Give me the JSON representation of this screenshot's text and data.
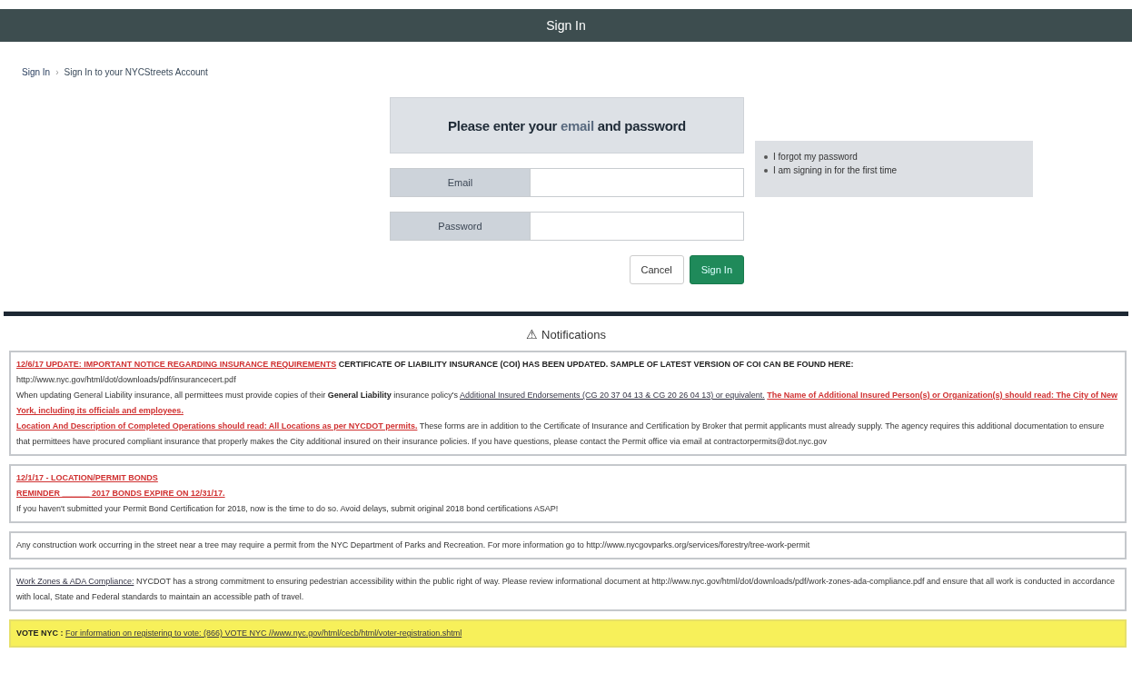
{
  "header": {
    "title": "Sign In"
  },
  "breadcrumb": [
    {
      "label": "Sign In",
      "kind": "link"
    },
    {
      "label": "›",
      "kind": "separator"
    },
    {
      "label": "Sign In to your NYCStreets Account",
      "kind": "current"
    }
  ],
  "form": {
    "heading": [
      {
        "text": "Please enter your ",
        "kind": "plain"
      },
      {
        "text": "email",
        "kind": "mark"
      },
      {
        "text": " and password",
        "kind": "plain"
      }
    ],
    "fields": [
      {
        "label": "Email"
      },
      {
        "label": "Password"
      }
    ],
    "buttons": [
      {
        "label": "Cancel",
        "kind": "secondary"
      },
      {
        "label": "Sign In",
        "kind": "primary"
      }
    ]
  },
  "help_links": [
    "I forgot my password",
    "I am signing in for the first time"
  ],
  "notifications": {
    "icon": "⚠",
    "title": "Notifications",
    "items": [
      {
        "highlighted": false,
        "lines": [
          [
            {
              "text": "12/6/17 UPDATE: IMPORTANT NOTICE REGARDING INSURANCE REQUIREMENTS",
              "kind": "alert"
            },
            {
              "text": "CERTIFICATE OF LIABILITY INSURANCE (COI) HAS BEEN UPDATED.  SAMPLE OF LATEST VERSION OF COI CAN BE FOUND HERE:",
              "kind": "bold"
            }
          ],
          [
            {
              "text": "http://www.nyc.gov/html/dot/downloads/pdf/insurancecert.pdf",
              "kind": "plain"
            }
          ],
          [
            {
              "text": "When updating General Liability insurance, all permittees must provide copies of their",
              "kind": "plain"
            },
            {
              "text": "General Liability",
              "kind": "bold"
            },
            {
              "text": "insurance policy's",
              "kind": "plain"
            },
            {
              "text": "Additional Insured Endorsements (CG 20 37 04 13 & CG 20 26 04 13) or equivalent.",
              "kind": "link"
            },
            {
              "text": "The Name of Additional Insured Person(s) or Organization(s) should read: The City of New York, including its officials and employees.",
              "kind": "alert"
            }
          ],
          [
            {
              "text": "Location And Description of Completed Operations should read: All Locations as per NYCDOT permits.",
              "kind": "alert"
            },
            {
              "text": "These forms are in addition to the Certificate of Insurance and Certification by Broker that permit applicants must already supply. The agency requires this additional documentation to ensure that permittees have procured compliant insurance that properly makes the City additional insured on their insurance policies.  If you have questions, please contact the Permit office via email at contractorpermits@dot.nyc.gov",
              "kind": "plain"
            }
          ]
        ]
      },
      {
        "highlighted": false,
        "lines": [
          [
            {
              "text": "12/1/17 - LOCATION/PERMIT BONDS",
              "kind": "alert"
            }
          ],
          [
            {
              "text": "REMINDER ______ 2017 BONDS EXPIRE ON 12/31/17.",
              "kind": "alert"
            }
          ],
          [
            {
              "text": "If you haven't submitted your Permit Bond Certification for 2018, now is the time to do so.  Avoid delays, submit original 2018 bond certifications ASAP!",
              "kind": "plain"
            }
          ]
        ]
      },
      {
        "highlighted": false,
        "lines": [
          [
            {
              "text": "Any construction work occurring in the street near a tree may require a permit from the NYC Department of Parks and Recreation. For more information go to http://www.nycgovparks.org/services/forestry/tree-work-permit",
              "kind": "plain"
            }
          ]
        ]
      },
      {
        "highlighted": false,
        "lines": [
          [
            {
              "text": "Work Zones & ADA Compliance:",
              "kind": "link"
            },
            {
              "text": "NYCDOT has a strong commitment to ensuring pedestrian accessibility within the public right of way. Please review informational document at http://www.nyc.gov/html/dot/downloads/pdf/work-zones-ada-compliance.pdf and ensure that all work is conducted in accordance with local, State and Federal standards to maintain an accessible path of travel.",
              "kind": "plain"
            }
          ]
        ]
      },
      {
        "highlighted": true,
        "lines": [
          [
            {
              "text": "VOTE NYC :",
              "kind": "bold"
            },
            {
              "text": "For information on registering to vote: (866) VOTE NYC  //www.nyc.gov/html/cecb/html/voter-registration.shtml",
              "kind": "link"
            }
          ]
        ]
      }
    ]
  }
}
